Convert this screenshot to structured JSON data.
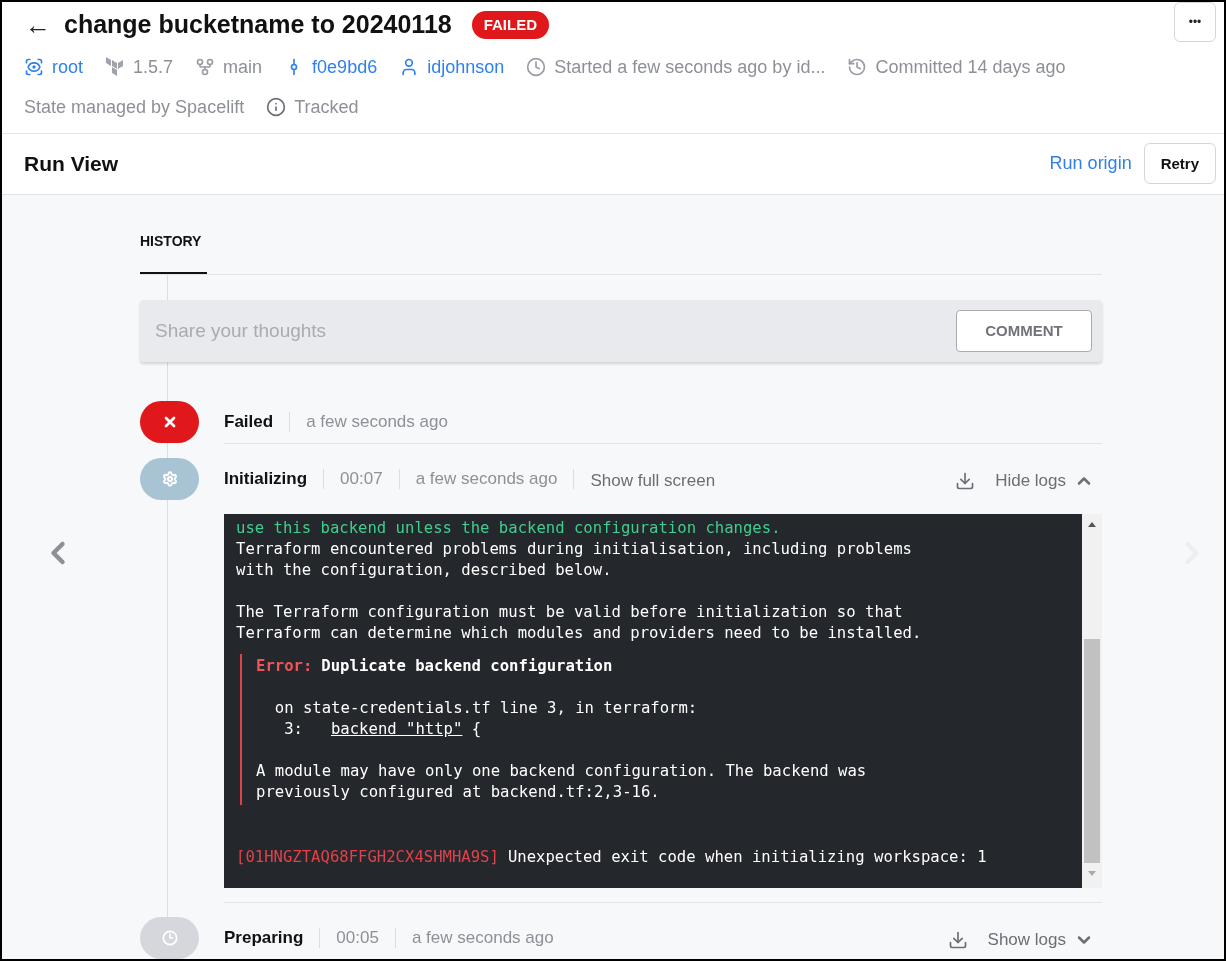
{
  "header": {
    "back": "←",
    "title": "change bucketname to 20240118",
    "status_badge": "FAILED",
    "more": "•••",
    "meta": [
      {
        "kind": "stack",
        "text": "root",
        "link": true
      },
      {
        "kind": "terraform",
        "text": "1.5.7",
        "link": false
      },
      {
        "kind": "branch",
        "text": "main",
        "link": false
      },
      {
        "kind": "commit",
        "text": "f0e9bd6",
        "link": true
      },
      {
        "kind": "user",
        "text": "idjohnson",
        "link": true
      },
      {
        "kind": "clock",
        "text": "Started a few seconds ago by id...",
        "link": false
      },
      {
        "kind": "history",
        "text": "Committed 14 days ago",
        "link": false
      },
      {
        "kind": "none",
        "text": "State managed by Spacelift",
        "link": false
      },
      {
        "kind": "info",
        "text": "Tracked",
        "link": false
      }
    ]
  },
  "run_view": {
    "title": "Run View",
    "origin_link": "Run origin",
    "retry": "Retry"
  },
  "tabs": [
    {
      "label": "HISTORY",
      "selected": true
    }
  ],
  "comment": {
    "placeholder": "Share your thoughts",
    "button": "COMMENT"
  },
  "nav": {
    "prev_disabled": false,
    "next_disabled": true
  },
  "steps": [
    {
      "kind": "failed",
      "label": "Failed",
      "time": "a few seconds ago"
    },
    {
      "kind": "initializing",
      "label": "Initializing",
      "duration": "00:07",
      "time": "a few seconds ago",
      "full_screen": "Show full screen",
      "logs_toggle": {
        "label": "Hide logs",
        "expanded": true
      },
      "log": {
        "lines": [
          {
            "kind": "success",
            "text": "use this backend unless the backend configuration changes."
          },
          {
            "kind": "plain",
            "text": "Terraform encountered problems during initialisation, including problems"
          },
          {
            "kind": "plain",
            "text": "with the configuration, described below."
          },
          {
            "kind": "blank"
          },
          {
            "kind": "plain",
            "text": "The Terraform configuration must be valid before initialization so that"
          },
          {
            "kind": "plain",
            "text": "Terraform can determine which modules and providers need to be installed."
          }
        ],
        "error": {
          "label": "Error:",
          "title": "Duplicate backend configuration",
          "items": [
            {
              "kind": "blank"
            },
            {
              "kind": "text",
              "text": "  on state-credentials.tf line 3, in terraform:"
            },
            {
              "kind": "code",
              "number": "   3:",
              "snippet": "backend \"http\"",
              "rest": " {"
            },
            {
              "kind": "blank"
            },
            {
              "kind": "text",
              "text": "A module may have only one backend configuration. The backend was"
            },
            {
              "kind": "text",
              "text": "previously configured at backend.tf:2,3-16."
            }
          ]
        },
        "footer": {
          "id": "[01HNGZTAQ68FFGH2CX4SHMHA9S]",
          "text": "Unexpected exit code when initializing workspace: 1"
        }
      }
    },
    {
      "kind": "preparing",
      "label": "Preparing",
      "duration": "00:05",
      "time": "a few seconds ago",
      "logs_toggle": {
        "label": "Show logs",
        "expanded": false
      }
    }
  ]
}
